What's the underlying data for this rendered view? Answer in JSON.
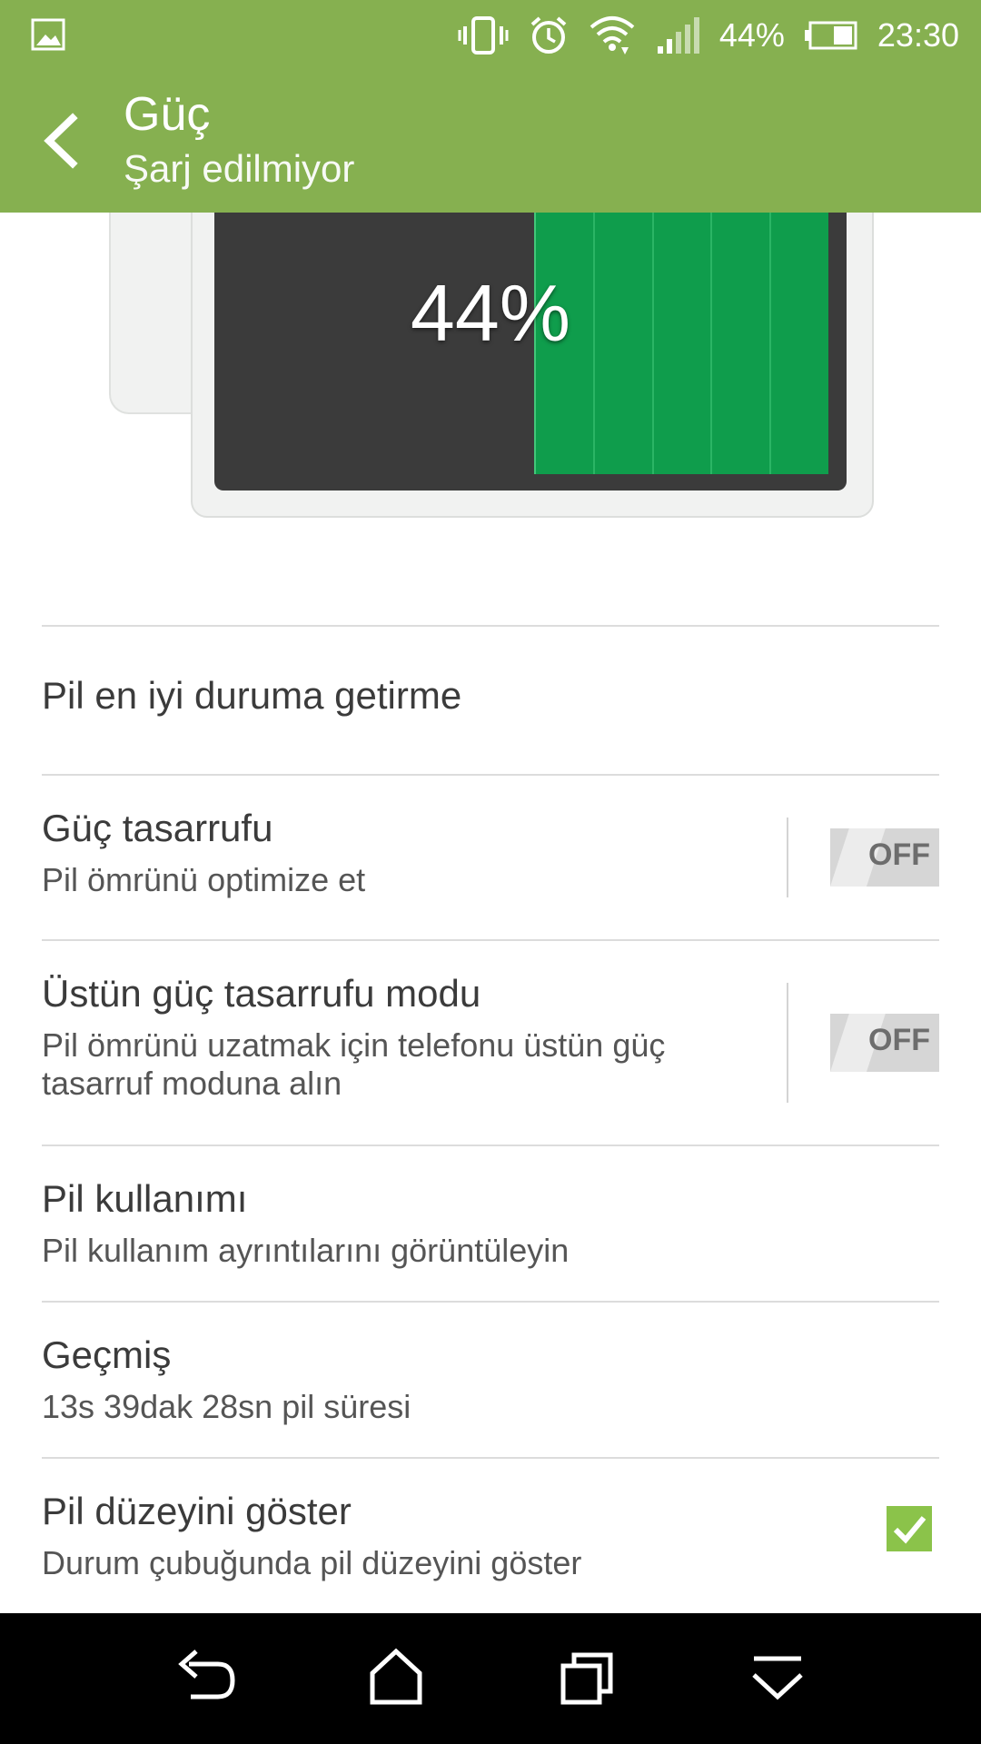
{
  "status_bar": {
    "battery_percent": "44%",
    "time": "23:30",
    "icons": [
      "gallery-icon",
      "vibrate-icon",
      "alarm-icon",
      "wifi-icon",
      "signal-icon",
      "battery-icon"
    ]
  },
  "app_bar": {
    "title": "Güç",
    "subtitle": "Şarj edilmiyor"
  },
  "battery_graphic": {
    "percent_label": "44%",
    "level": 0.44,
    "fill_color": "#0f9d4c"
  },
  "settings": {
    "optimize": {
      "title": "Pil en iyi duruma getirme"
    },
    "power_saver": {
      "title": "Güç tasarrufu",
      "subtitle": "Pil ömrünü optimize et",
      "toggle": "OFF"
    },
    "extreme_saver": {
      "title": "Üstün güç tasarrufu modu",
      "subtitle_line1": "Pil ömrünü uzatmak için telefonu üstün güç",
      "subtitle_line2": "tasarruf moduna alın",
      "toggle": "OFF"
    },
    "usage": {
      "title": "Pil kullanımı",
      "subtitle": "Pil kullanım ayrıntılarını görüntüleyin"
    },
    "history": {
      "title": "Geçmiş",
      "subtitle": "13s 39dak 28sn pil süresi"
    },
    "show_level": {
      "title": "Pil düzeyini göster",
      "subtitle": "Durum çubuğunda pil düzeyini göster",
      "checked": true
    }
  },
  "colors": {
    "accent": "#86b050",
    "checkbox": "#8bc34a"
  },
  "nav_bar": {
    "buttons": [
      "back-icon",
      "home-icon",
      "recents-icon",
      "menu-down-icon"
    ]
  }
}
